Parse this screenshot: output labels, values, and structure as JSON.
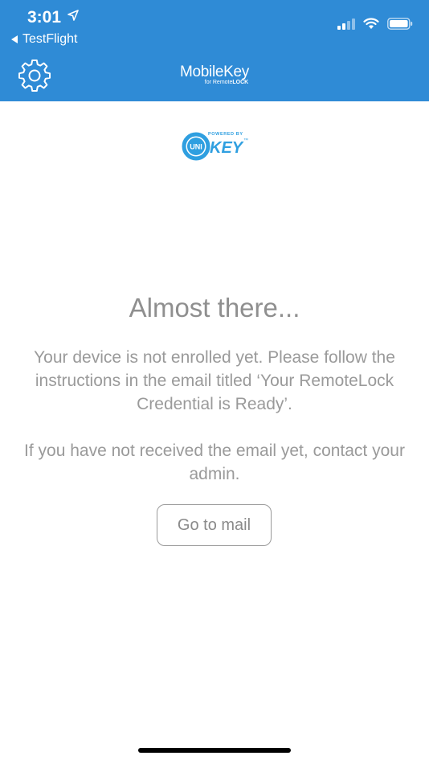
{
  "status_bar": {
    "time": "3:01",
    "back_label": "TestFlight"
  },
  "header": {
    "app_name": "MobileKey",
    "app_sub_prefix": "for Remote",
    "app_sub_suffix": "LOCK",
    "settings_icon": "gear-icon"
  },
  "brand": {
    "powered_by": "POWERED BY",
    "uni": "UNI",
    "key": "KEY",
    "tm": "™"
  },
  "main": {
    "title": "Almost there...",
    "message_line1": "Your device is not enrolled yet. Please follow the instructions in the email titled ‘Your RemoteLock Credential is Ready’.",
    "message_line2": "If you have not received the email yet, contact your admin.",
    "mail_button": "Go to mail"
  },
  "colors": {
    "header_bg": "#2f8bd6",
    "text_gray": "#9a9a9a"
  }
}
